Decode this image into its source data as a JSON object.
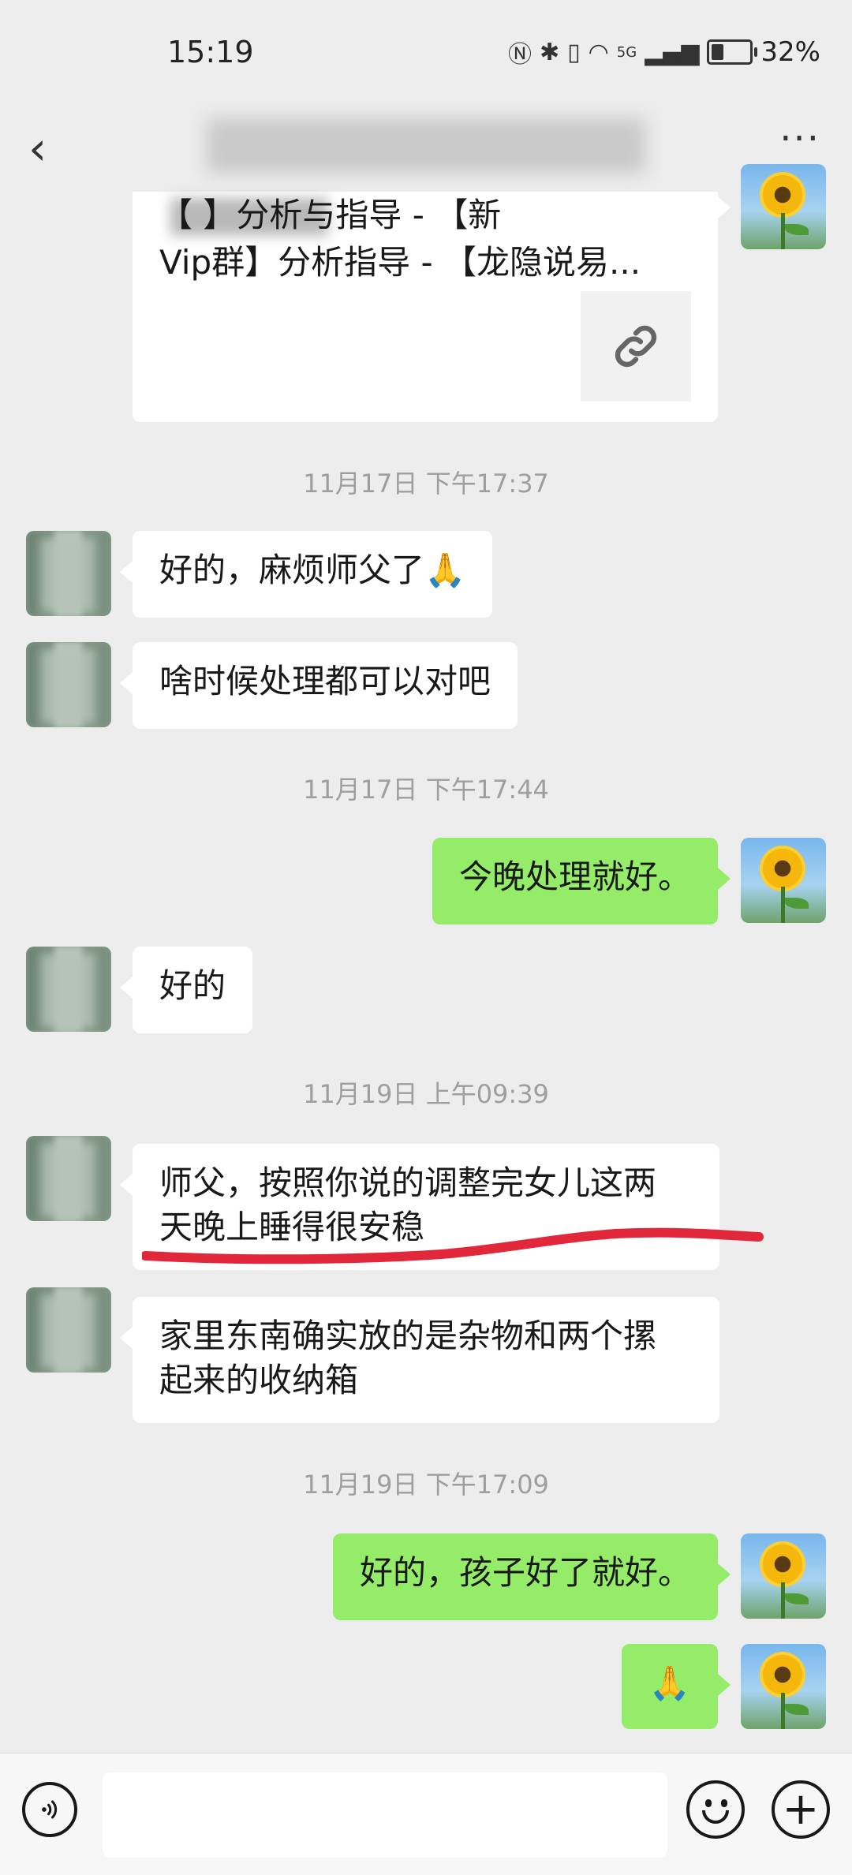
{
  "status_bar": {
    "time": "15:19",
    "network": "5G",
    "battery": "32%"
  },
  "header": {
    "title": "",
    "more": "···"
  },
  "link_card": {
    "line1": "【     】分析与指导 - 【新",
    "line2": "Vip群】分析指导 - 【龙隐说易..."
  },
  "messages": [
    {
      "type": "time",
      "text": "11月17日 下午17:37"
    },
    {
      "type": "in",
      "text": "好的，麻烦师父了🙏"
    },
    {
      "type": "in",
      "text": "啥时候处理都可以对吧"
    },
    {
      "type": "time",
      "text": "11月17日 下午17:44"
    },
    {
      "type": "out",
      "text": "今晚处理就好。"
    },
    {
      "type": "in",
      "text": "好的"
    },
    {
      "type": "time",
      "text": "11月19日 上午09:39"
    },
    {
      "type": "in",
      "line1": "师父，按照你说的调整完女儿这两",
      "line2": "天晚上睡得很安稳"
    },
    {
      "type": "in",
      "line1": "家里东南确实放的是杂物和两个摞",
      "line2": "起来的收纳箱"
    },
    {
      "type": "time",
      "text": "11月19日 下午17:09"
    },
    {
      "type": "out",
      "text": "好的，孩子好了就好。"
    },
    {
      "type": "out",
      "text": "🙏"
    }
  ],
  "colors": {
    "bg": "#ededed",
    "green_bubble": "#95ec69",
    "white_bubble": "#ffffff",
    "underline": "#e0283a"
  },
  "icons": [
    "back-icon",
    "more-icon",
    "link-icon",
    "voice-icon",
    "emoji-icon",
    "plus-icon"
  ]
}
